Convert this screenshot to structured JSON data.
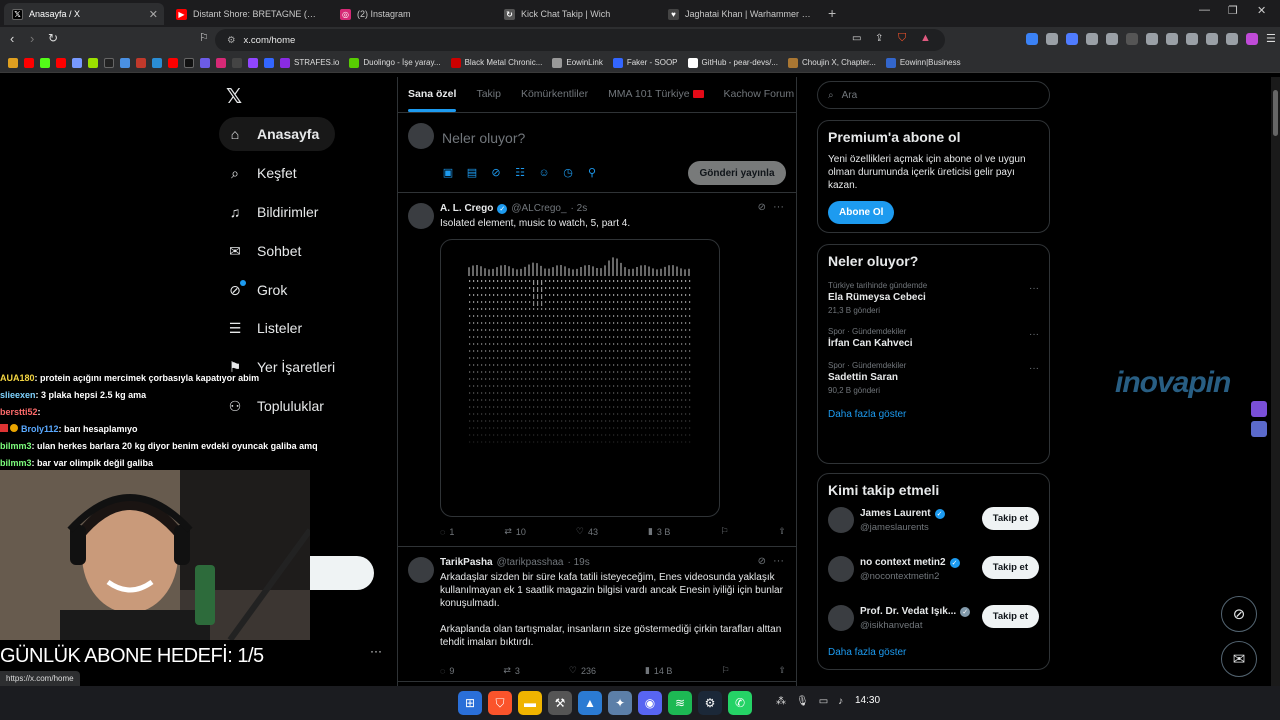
{
  "browser": {
    "tabs": [
      {
        "title": "Anasayfa / X",
        "icon_color": "#000000",
        "icon_glyph": "𝕏"
      },
      {
        "title": "Distant Shore: BRETAGNE (Gameplay",
        "icon_color": "#ff0000",
        "icon_glyph": "▶"
      },
      {
        "title": "(2) Instagram",
        "icon_color": "#d62976",
        "icon_glyph": "◎"
      },
      {
        "title": "Kick Chat Takip | Wich",
        "icon_color": "#555555",
        "icon_glyph": "↻"
      },
      {
        "title": "Jaghatai Khan | Warhammer 40k Wiki",
        "icon_color": "#444444",
        "icon_glyph": "♥"
      }
    ],
    "new_tab": "+",
    "url": "x.com/home",
    "bookmarks": [
      {
        "label": "STRAFES.io",
        "color": "#8a2be2"
      },
      {
        "label": "Duolingo - İşe yaray...",
        "color": "#58cc02"
      },
      {
        "label": "Black Metal Chronic...",
        "color": "#cc0000"
      },
      {
        "label": "EowinLink",
        "color": "#999999"
      },
      {
        "label": "Faker - SOOP",
        "color": "#3366ff"
      },
      {
        "label": "GitHub - pear-devs/...",
        "color": "#ffffff"
      },
      {
        "label": "Choujin X, Chapter...",
        "color": "#aa7733"
      },
      {
        "label": "Eowinn|Business",
        "color": "#3366cc"
      }
    ],
    "status_url": "https://x.com/home"
  },
  "sidebar": {
    "items": [
      {
        "label": "Anasayfa",
        "icon": "home-icon",
        "glyph": "⌂"
      },
      {
        "label": "Keşfet",
        "icon": "search-icon",
        "glyph": "⌕"
      },
      {
        "label": "Bildirimler",
        "icon": "bell-icon",
        "glyph": "♫"
      },
      {
        "label": "Sohbet",
        "icon": "mail-icon",
        "glyph": "✉"
      },
      {
        "label": "Grok",
        "icon": "grok-icon",
        "glyph": "⊘"
      },
      {
        "label": "Listeler",
        "icon": "list-icon",
        "glyph": "☰"
      },
      {
        "label": "Yer İşaretleri",
        "icon": "bookmark-icon",
        "glyph": "⚑"
      },
      {
        "label": "Topluluklar",
        "icon": "communities-icon",
        "glyph": "⚇"
      }
    ]
  },
  "feed": {
    "tabs": [
      "Sana özel",
      "Takip",
      "Kömürkentliler",
      "MMA 101 Türkiye",
      "Kachow Forum"
    ],
    "compose_placeholder": "Neler oluyor?",
    "post_button": "Gönderi yayınla",
    "tweets": [
      {
        "name": "A. L. Crego",
        "handle": "@ALCrego_",
        "time": "· 2s",
        "text": [
          "Isolated element, music to watch, 5, part 4."
        ],
        "replies": "1",
        "reposts": "10",
        "likes": "43",
        "views": "3 B"
      },
      {
        "name": "TarikPasha",
        "handle": "@tarikpasshaa",
        "time": "· 19s",
        "text": [
          "Arkadaşlar sizden bir süre kafa tatili isteyeceğim, Enes videosunda yaklaşık kullanılmayan ek 1 saatlik magazin bilgisi vardı ancak Enesin iyiliği için bunlar konuşulmadı.",
          "Arkaplanda olan tartışmalar, insanların size göstermediği çirkin tarafları alttan tehdit imaları bıktırdı."
        ],
        "replies": "9",
        "reposts": "3",
        "likes": "236",
        "views": "14 B"
      }
    ]
  },
  "right": {
    "search_placeholder": "Ara",
    "premium": {
      "title": "Premium'a abone ol",
      "text": "Yeni özellikleri açmak için abone ol ve uygun olman durumunda içerik üreticisi gelir payı kazan.",
      "button": "Abone Ol"
    },
    "trends": {
      "title": "Neler oluyor?",
      "items": [
        {
          "context": "Türkiye tarihinde gündemde",
          "name": "Ela Rümeysa Cebeci",
          "count": "21,3 B gönderi"
        },
        {
          "context": "Spor · Gündemdekiler",
          "name": "İrfan Can Kahveci",
          "count": ""
        },
        {
          "context": "Spor · Gündemdekiler",
          "name": "Sadettin Saran",
          "count": "90,2 B gönderi"
        }
      ],
      "show_more": "Daha fazla göster"
    },
    "who_to_follow": {
      "title": "Kimi takip etmeli",
      "items": [
        {
          "name": "James Laurent",
          "handle": "@jameslaurents",
          "button": "Takip et"
        },
        {
          "name": "no context metin2",
          "handle": "@nocontextmetin2",
          "button": "Takip et"
        },
        {
          "name": "Prof. Dr. Vedat Işık...",
          "handle": "@isikhanvedat",
          "button": "Takip et"
        }
      ],
      "show_more": "Daha fazla göster"
    }
  },
  "stream": {
    "chat": [
      {
        "user": "AUA180",
        "user_color": "#f5d742",
        "msg": ": protein açığını mercimek çorbasıyla kapatıyor abim"
      },
      {
        "user": "slieexen",
        "user_color": "#7fd3ff",
        "msg": ": 3 plaka hepsi 2.5 kg ama"
      },
      {
        "user": "berstti52",
        "user_color": "#ff6b6b",
        "msg": ":"
      },
      {
        "user": "Broly112",
        "user_color": "#5aa9ff",
        "msg": ": barı hesaplamıyo"
      },
      {
        "user": "bilmm3",
        "user_color": "#7dff7d",
        "msg": ": ulan herkes barlara 20 kg diyor benim evdeki oyuncak galiba amq"
      },
      {
        "user": "bilmm3",
        "user_color": "#7dff7d",
        "msg": ": bar var        olimpik değil galiba"
      }
    ],
    "goal": "GÜNLÜK ABONE HEDEFİ: 1/5",
    "watermark": "inovapin"
  },
  "taskbar": {
    "time": "14:30"
  }
}
